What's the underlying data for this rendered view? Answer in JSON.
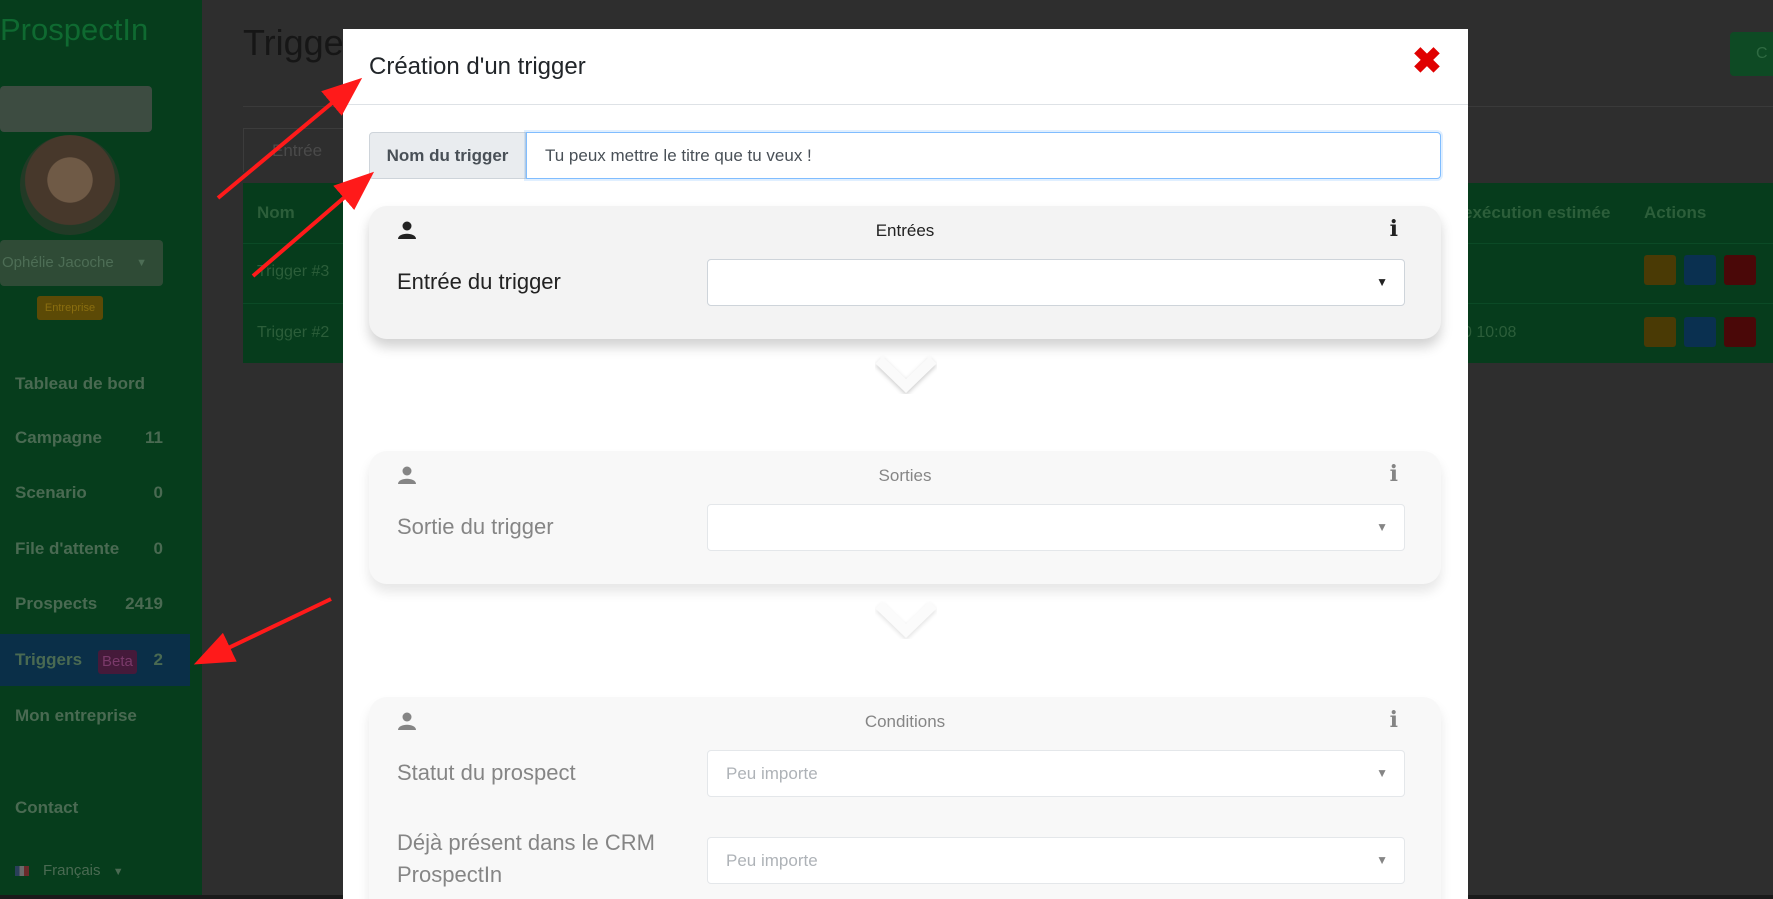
{
  "background": {
    "brand": "ProspectIn",
    "user": "Ophélie Jacoche",
    "plan_badge": "Entreprise",
    "nav": [
      {
        "label": "Tableau de bord",
        "count": ""
      },
      {
        "label": "Campagne",
        "count": "11"
      },
      {
        "label": "Scenario",
        "count": "0"
      },
      {
        "label": "File d'attente",
        "count": "0"
      },
      {
        "label": "Prospects",
        "count": "2419"
      },
      {
        "label": "Triggers",
        "count": "2",
        "badge": "Beta"
      },
      {
        "label": "Mon entreprise",
        "count": ""
      }
    ],
    "contact": "Contact",
    "language": "Français",
    "page_title": "Trigge",
    "top_button": "C",
    "tab_label": "Entrée",
    "table": {
      "headers": [
        "Nom",
        "exécution estimée",
        "Actions"
      ],
      "rows": [
        {
          "name": "Trigger #3",
          "date": ""
        },
        {
          "name": "Trigger #2",
          "date": "0 10:08"
        }
      ]
    }
  },
  "modal": {
    "title": "Création d'un trigger",
    "close_symbol": "✖",
    "name_label": "Nom du trigger",
    "name_value": "Tu peux mettre le titre que tu veux !",
    "sections": [
      {
        "title": "Entrées",
        "info": "i",
        "fields": [
          {
            "label": "Entrée du trigger",
            "value": ""
          }
        ]
      },
      {
        "title": "Sorties",
        "info": "i",
        "fields": [
          {
            "label": "Sortie du trigger",
            "value": ""
          }
        ]
      },
      {
        "title": "Conditions",
        "info": "i",
        "fields": [
          {
            "label": "Statut du prospect",
            "value": "Peu importe"
          },
          {
            "label": "Déjà présent dans le CRM ProspectIn",
            "value": "Peu importe"
          }
        ]
      }
    ]
  },
  "colors": {
    "annotation_arrow": "#ff1a1a",
    "close": "#e00000",
    "overlay_sidebar": "#063d1c"
  }
}
